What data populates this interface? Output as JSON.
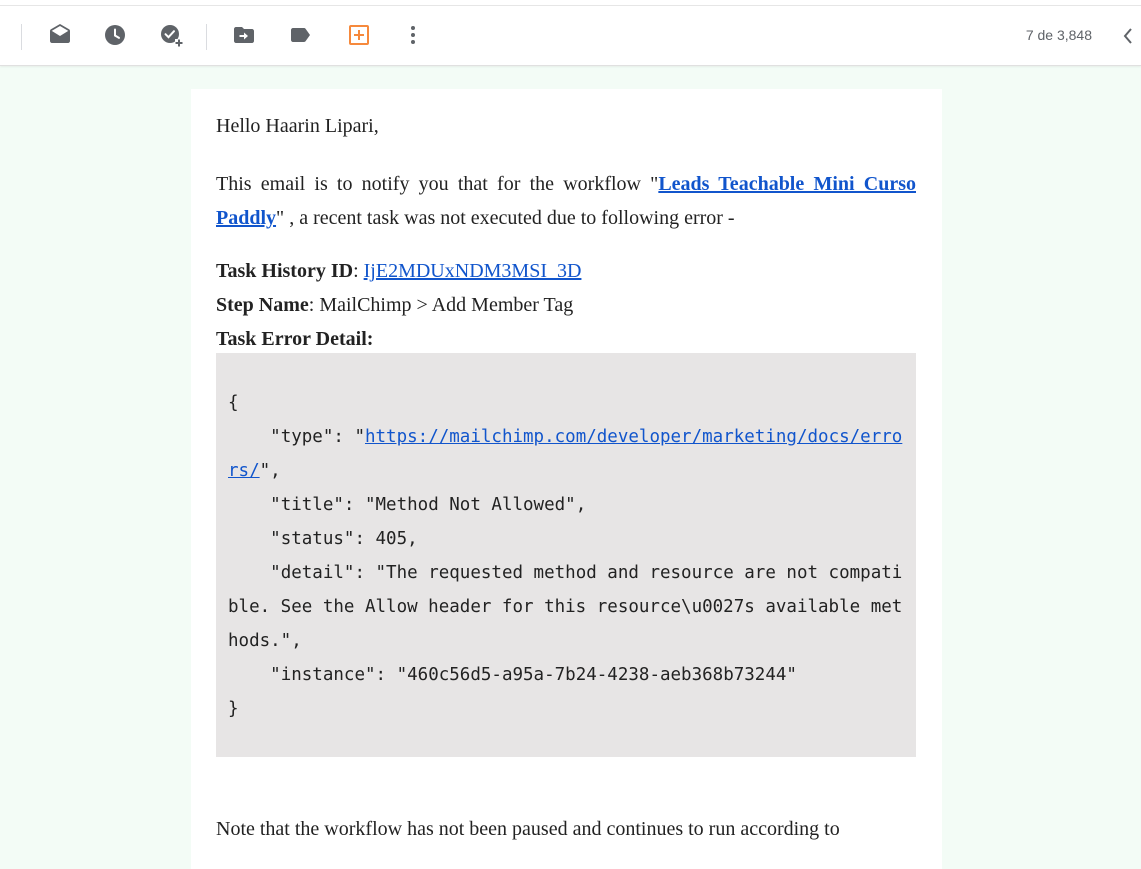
{
  "toolbar": {
    "icons": [
      "mark-read-icon",
      "snooze-icon",
      "add-task-icon",
      "move-to-icon",
      "label-icon",
      "add-on-icon",
      "more-vert-icon"
    ],
    "counter": "7 de 3,848",
    "accent": "#f6893c"
  },
  "email": {
    "greeting": "Hello Haarin Lipari,",
    "intro_before": "This email is to notify you that for the workflow \"",
    "workflow_link": "Leads Teachable Mini Curso Paddly",
    "intro_after": "\" , a recent task was not executed due to following error -",
    "task_history_label": "Task History ID",
    "task_history_id": "IjE2MDUxNDM3MSI_3D",
    "step_name_label": "Step Name",
    "step_name_value": ": MailChimp > Add Member Tag",
    "error_detail_label": "Task Error Detail:",
    "error_json": {
      "open": "{",
      "type_prefix": "    \"type\": \"",
      "type_url": "https://mailchimp.com/developer/marketing/docs/errors/",
      "type_suffix": "\",",
      "title_line": "    \"title\": \"Method Not Allowed\",",
      "status_line": "    \"status\": 405,",
      "detail_line": "    \"detail\": \"The requested method and resource are not compatible. See the Allow header for this resource\\u0027s available methods.\",",
      "instance_line": "    \"instance\": \"460c56d5-a95a-7b24-4238-aeb368b73244\"",
      "close": "}"
    },
    "note": "Note that the workflow has not been paused and continues to run according to"
  }
}
